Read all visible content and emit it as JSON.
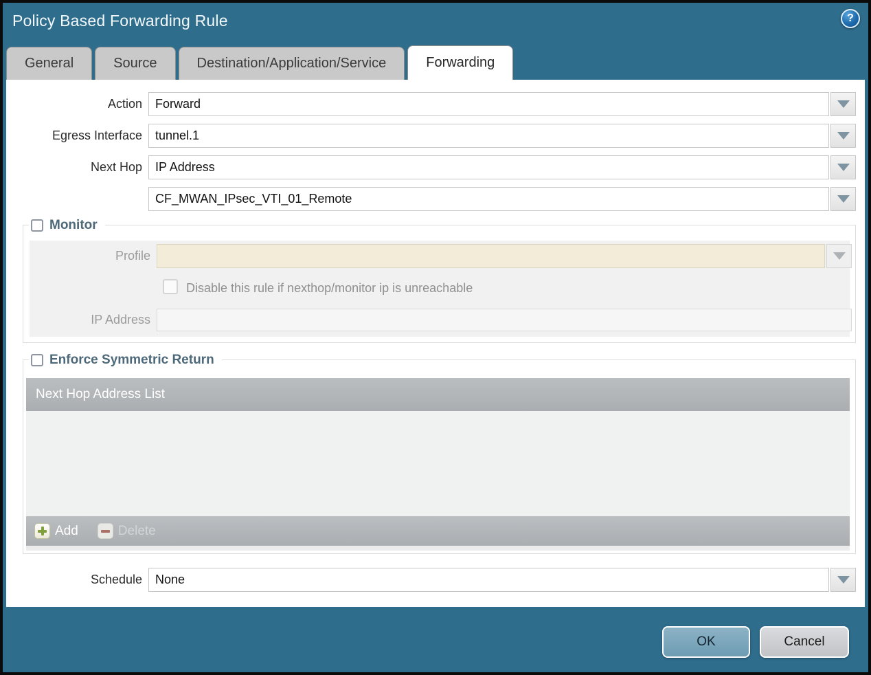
{
  "dialog": {
    "title": "Policy Based Forwarding Rule",
    "help_glyph": "?"
  },
  "tabs": [
    {
      "label": "General",
      "active": false
    },
    {
      "label": "Source",
      "active": false
    },
    {
      "label": "Destination/Application/Service",
      "active": false
    },
    {
      "label": "Forwarding",
      "active": true
    }
  ],
  "form": {
    "action": {
      "label": "Action",
      "value": "Forward"
    },
    "egress_interface": {
      "label": "Egress Interface",
      "value": "tunnel.1"
    },
    "next_hop": {
      "label": "Next Hop",
      "value": "IP Address"
    },
    "next_hop_address": {
      "value": "CF_MWAN_IPsec_VTI_01_Remote"
    },
    "schedule": {
      "label": "Schedule",
      "value": "None"
    }
  },
  "monitor": {
    "legend": "Monitor",
    "checked": false,
    "profile": {
      "label": "Profile",
      "value": ""
    },
    "disable_rule": {
      "label": "Disable this rule if nexthop/monitor ip is unreachable",
      "checked": false
    },
    "ip_address": {
      "label": "IP Address",
      "value": ""
    }
  },
  "enforce_symmetric_return": {
    "legend": "Enforce Symmetric Return",
    "checked": false,
    "table": {
      "header": "Next Hop Address List",
      "rows": []
    },
    "add_label": "Add",
    "delete_label": "Delete"
  },
  "footer": {
    "ok_label": "OK",
    "cancel_label": "Cancel"
  },
  "colors": {
    "titlebar_teal": "#2F6D8D",
    "inactive_tab_gray": "#C9C9C9",
    "active_tab_white": "#FFFFFF",
    "disabled_field_beige": "#F2ECD8",
    "table_header_gray": "#B2B6B9",
    "table_body_gray": "#F0F1F1",
    "ok_button_blue": "#7FA9BE",
    "cancel_button_gray": "#CDCDD1",
    "add_plus_green": "#7FA03A",
    "delete_minus_red": "#AB7166",
    "dropdown_arrow_slate": "#7E94A2",
    "legend_text_slate": "#4D6878",
    "help_icon_blue": "#1E6CAE"
  }
}
